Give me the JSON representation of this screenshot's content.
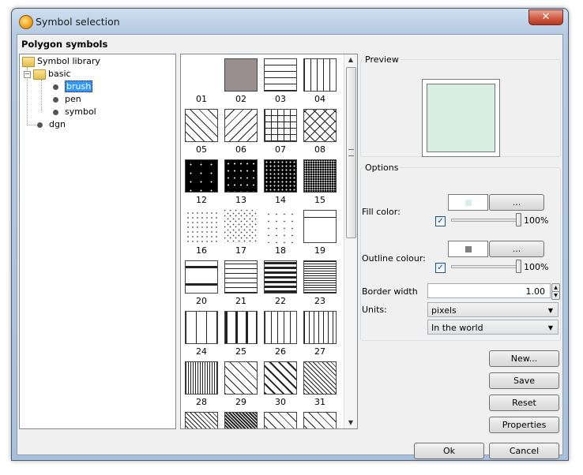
{
  "window": {
    "title": "Symbol selection",
    "close_label": "✕"
  },
  "section_title": "Polygon symbols",
  "tree": {
    "root": "Symbol library",
    "folder": "basic",
    "children": [
      "brush",
      "pen",
      "symbol"
    ],
    "other": "dgn",
    "selected": "brush"
  },
  "symbols": [
    {
      "label": "01",
      "pattern": "blank"
    },
    {
      "label": "02",
      "pattern": "solid-gray"
    },
    {
      "label": "03",
      "pattern": "horizontal"
    },
    {
      "label": "04",
      "pattern": "vertical"
    },
    {
      "label": "05",
      "pattern": "diag-up"
    },
    {
      "label": "06",
      "pattern": "diag-down"
    },
    {
      "label": "07",
      "pattern": "grid"
    },
    {
      "label": "08",
      "pattern": "cross-diag"
    },
    {
      "label": "12",
      "pattern": "black-sparse"
    },
    {
      "label": "13",
      "pattern": "black-dots"
    },
    {
      "label": "14",
      "pattern": "black-dots-dense"
    },
    {
      "label": "15",
      "pattern": "black-grid"
    },
    {
      "label": "16",
      "pattern": "dots-grid"
    },
    {
      "label": "17",
      "pattern": "dots-scatter"
    },
    {
      "label": "18",
      "pattern": "dots-sparse"
    },
    {
      "label": "19",
      "pattern": "frame-top"
    },
    {
      "label": "20",
      "pattern": "thick-horizontal"
    },
    {
      "label": "21",
      "pattern": "horizontal-medium"
    },
    {
      "label": "22",
      "pattern": "thick-horizontal-dense"
    },
    {
      "label": "23",
      "pattern": "horizontal-dense"
    },
    {
      "label": "24",
      "pattern": "vertical-wide"
    },
    {
      "label": "25",
      "pattern": "thick-vertical"
    },
    {
      "label": "26",
      "pattern": "vertical"
    },
    {
      "label": "27",
      "pattern": "vertical-medium"
    },
    {
      "label": "28",
      "pattern": "vertical-dense"
    },
    {
      "label": "29",
      "pattern": "diag-up"
    },
    {
      "label": "30",
      "pattern": "thick-diag"
    },
    {
      "label": "31",
      "pattern": "diag-dense"
    },
    {
      "label": "",
      "pattern": "diag-dense"
    },
    {
      "label": "",
      "pattern": "black-hatch"
    },
    {
      "label": "",
      "pattern": "diag-up"
    },
    {
      "label": "",
      "pattern": "diag-up"
    }
  ],
  "preview": {
    "legend": "Preview",
    "fill_color": "#d8f0e2"
  },
  "options": {
    "legend": "Options",
    "fill_color_label": "Fill color:",
    "fill_swatch": "#d8f0e2",
    "fill_opacity": "100%",
    "fill_opacity_value": 1.0,
    "outline_label": "Outline colour:",
    "outline_swatch": "#808080",
    "outline_opacity": "100%",
    "outline_opacity_value": 1.0,
    "more_label": "...",
    "border_width_label": "Border width",
    "border_width_value": "1.00",
    "units_label": "Units:",
    "units_value": "pixels",
    "scope_value": "In the world"
  },
  "actions": {
    "new": "New...",
    "save": "Save",
    "reset": "Reset",
    "properties": "Properties"
  },
  "dialog": {
    "ok": "Ok",
    "cancel": "Cancel"
  }
}
